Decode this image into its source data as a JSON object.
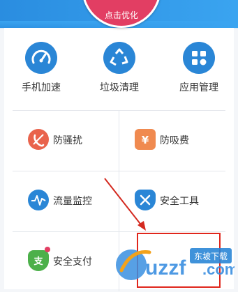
{
  "header": {
    "optimize_label": "点击优化"
  },
  "tools": [
    {
      "label": "手机加速",
      "icon": "speedometer-icon"
    },
    {
      "label": "垃圾清理",
      "icon": "recycle-icon"
    },
    {
      "label": "应用管理",
      "icon": "apps-grid-icon"
    }
  ],
  "features": [
    {
      "label": "防骚扰",
      "icon": "phone-block-icon",
      "color": "#e9634c"
    },
    {
      "label": "防吸费",
      "icon": "yuan-shield-icon",
      "color": "#f08a50"
    },
    {
      "label": "流量监控",
      "icon": "traffic-pulse-icon",
      "color": "#2a86d6"
    },
    {
      "label": "安全工具",
      "icon": "tools-shield-icon",
      "color": "#2a86d6"
    },
    {
      "label": "安全支付",
      "icon": "pay-shield-icon",
      "color": "#4cb04a"
    }
  ],
  "watermark": {
    "brand": "uzzf.com",
    "badge": "东坡下载"
  },
  "colors": {
    "header": "#2a8de0",
    "optimize": "#e23e63",
    "accent_red": "#e0261c"
  }
}
